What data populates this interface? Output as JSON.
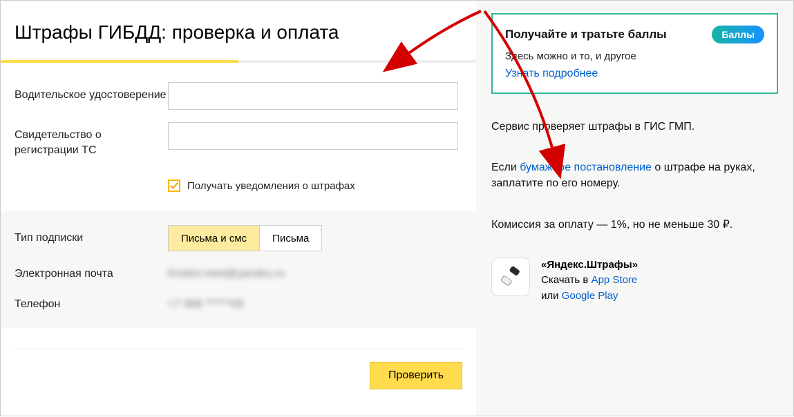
{
  "page": {
    "title": "Штрафы ГИБДД: проверка и оплата"
  },
  "form": {
    "driverLicenseLabel": "Водительское удостоверение",
    "registrationLabel": "Свидетельство о регистрации ТС",
    "notifyCheckboxLabel": "Получать уведомления о штрафах"
  },
  "subscription": {
    "typeLabel": "Тип подписки",
    "optionBoth": "Письма и смс",
    "optionEmail": "Письма",
    "emailLabel": "Электронная почта",
    "emailValue": "Kristini.mint@yandex.ru",
    "phoneLabel": "Телефон",
    "phoneValue": "+7 968 ******09"
  },
  "submit": {
    "checkButton": "Проверить"
  },
  "promo": {
    "title": "Получайте и тратьте баллы",
    "badge": "Баллы",
    "subtitle": "Здесь можно и то, и другое",
    "learnMore": "Узнать подробнее"
  },
  "info": {
    "line1": "Сервис проверяет штрафы в ГИС ГМП.",
    "line2a": "Если ",
    "line2link": "бумажное постановление",
    "line2b": " о штрафе на руках, заплатите по его номеру.",
    "line3": "Комиссия за оплату — 1%, но не меньше 30 ₽."
  },
  "app": {
    "title": "«Яндекс.Штрафы»",
    "downloadPrefix": "Скачать в ",
    "appStore": "App Store",
    "or": "или ",
    "googlePlay": "Google Play"
  }
}
